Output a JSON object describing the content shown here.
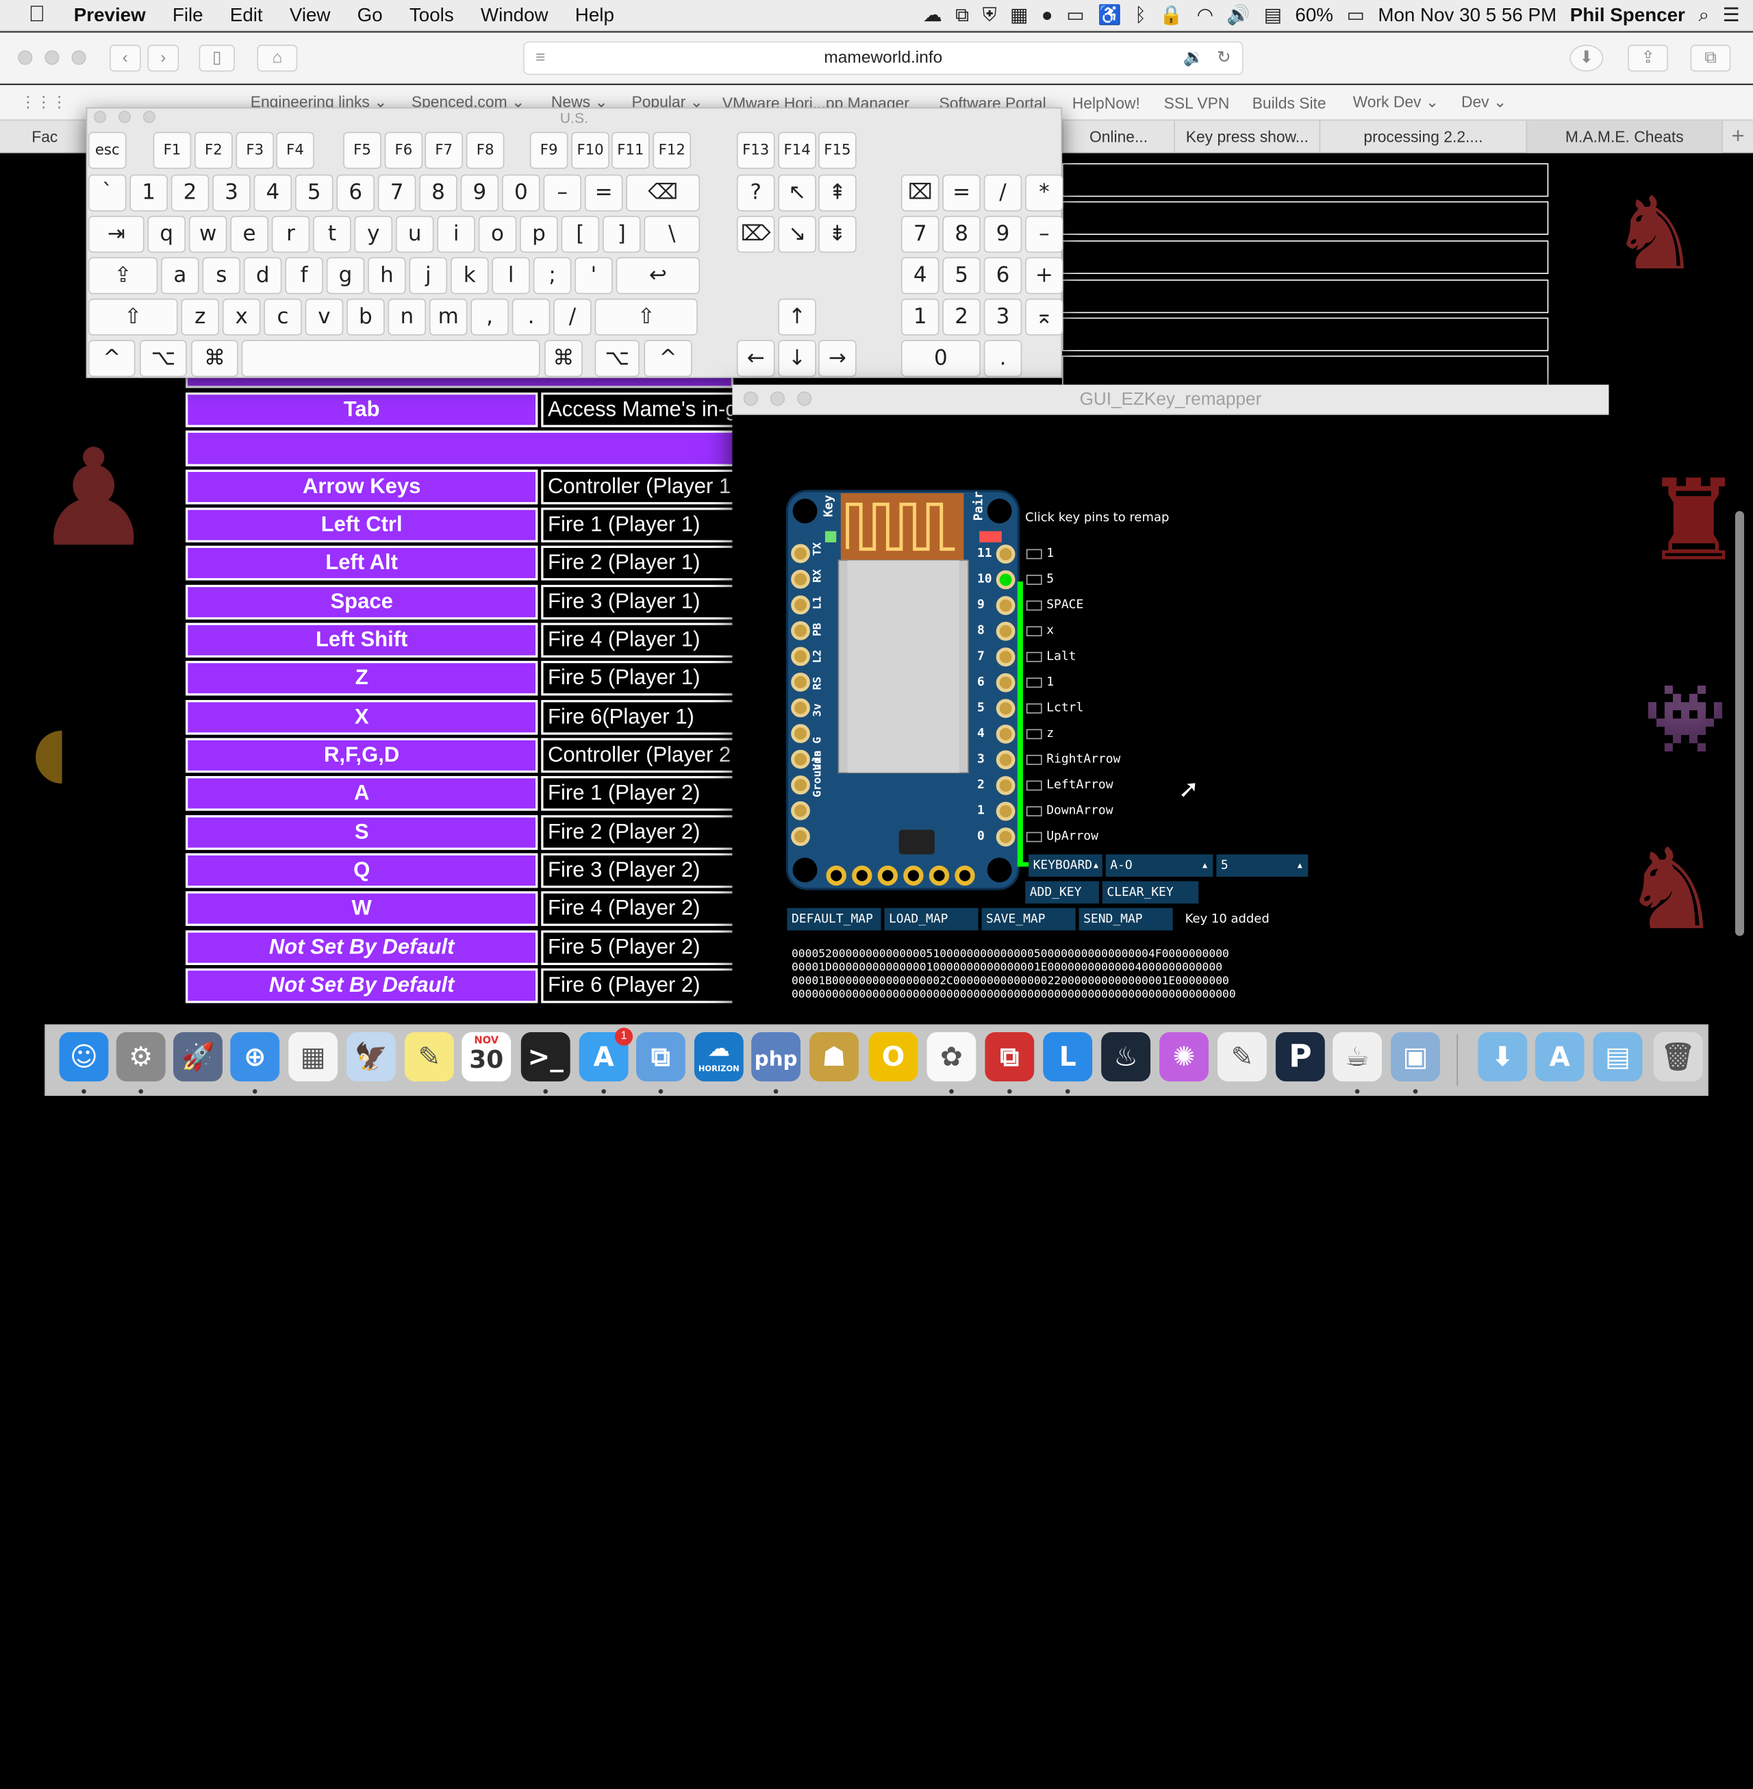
{
  "menubar": {
    "app_name": "Preview",
    "menus": [
      "File",
      "Edit",
      "View",
      "Go",
      "Tools",
      "Window",
      "Help"
    ],
    "battery": "60%",
    "clock": "Mon Nov 30  5 56 PM",
    "user": "Phil Spencer"
  },
  "browser": {
    "url": "mameworld.info",
    "favorites": [
      "Engineering links ⌄",
      "Spenced.com ⌄",
      "News ⌄",
      "Popular ⌄",
      "VMware Hori...pp Manager",
      "Software Portal",
      "HelpNow!",
      "SSL VPN",
      "Builds Site",
      "Work Dev ⌄",
      "Dev ⌄"
    ],
    "tabs": [
      "Fac",
      "Online...",
      "Key press show...",
      "processing 2.2....",
      "M.A.M.E. Cheats"
    ],
    "new_tab": "+"
  },
  "keyboard_viewer": {
    "title": "U.S.",
    "keys": {
      "esc": "esc",
      "f": [
        "F1",
        "F2",
        "F3",
        "F4",
        "F5",
        "F6",
        "F7",
        "F8",
        "F9",
        "F10",
        "F11",
        "F12",
        "F13",
        "F14",
        "F15"
      ],
      "num_row": [
        "`",
        "1",
        "2",
        "3",
        "4",
        "5",
        "6",
        "7",
        "8",
        "9",
        "0",
        "–",
        "=",
        "⌫"
      ],
      "q_row": [
        "⇥",
        "q",
        "w",
        "e",
        "r",
        "t",
        "y",
        "u",
        "i",
        "o",
        "p",
        "[",
        "]",
        "\\"
      ],
      "a_row": [
        "⇪",
        "a",
        "s",
        "d",
        "f",
        "g",
        "h",
        "j",
        "k",
        "l",
        ";",
        "'",
        "↩"
      ],
      "z_row": [
        "⇧",
        "z",
        "x",
        "c",
        "v",
        "b",
        "n",
        "m",
        ",",
        ".",
        "/",
        "⇧"
      ],
      "bottom_row": [
        "^",
        "⌥",
        "⌘",
        "⌘",
        "⌥",
        "^"
      ],
      "nav": [
        "?",
        "↖",
        "⇞",
        "⌦",
        "↘",
        "⇟",
        "↑",
        "←",
        "↓",
        "→"
      ],
      "numpad": [
        "⌧",
        "=",
        "/",
        "*",
        "7",
        "8",
        "9",
        "–",
        "4",
        "5",
        "6",
        "+",
        "1",
        "2",
        "3",
        "0",
        ".",
        "⌅"
      ]
    }
  },
  "mame_table": {
    "rows": [
      {
        "key": "Tab",
        "action": "Access Mame's in-g"
      },
      {
        "key": "Arrow Keys",
        "action": "Controller (Player 1"
      },
      {
        "key": "Left Ctrl",
        "action": "Fire 1 (Player 1)"
      },
      {
        "key": "Left Alt",
        "action": "Fire 2 (Player 1)"
      },
      {
        "key": "Space",
        "action": "Fire 3 (Player 1)"
      },
      {
        "key": "Left Shift",
        "action": "Fire 4 (Player 1)"
      },
      {
        "key": "Z",
        "action": "Fire 5 (Player 1)"
      },
      {
        "key": "X",
        "action": "Fire 6(Player 1)"
      },
      {
        "key": "R,F,G,D",
        "action": "Controller (Player 2"
      },
      {
        "key": "A",
        "action": "Fire 1 (Player 2)"
      },
      {
        "key": "S",
        "action": "Fire 2 (Player 2)"
      },
      {
        "key": "Q",
        "action": "Fire 3 (Player 2)"
      },
      {
        "key": "W",
        "action": "Fire 4 (Player 2)"
      },
      {
        "key": "Not Set By Default",
        "action": "Fire 5 (Player 2)"
      },
      {
        "key": "Not Set By Default",
        "action": "Fire 6 (Player 2)"
      }
    ]
  },
  "remapper": {
    "title": "GUI_EZKey_remapper",
    "instruction": "Click key pins to remap",
    "board_labels": {
      "key": "Key",
      "pair": "Pair",
      "left": [
        "TX",
        "RX",
        "L1",
        "PB",
        "L2",
        "RS",
        "3v",
        "G",
        "Vin",
        "Grounds"
      ]
    },
    "pins": [
      {
        "num": "11",
        "label": "1"
      },
      {
        "num": "10",
        "label": "5"
      },
      {
        "num": "9",
        "label": "SPACE"
      },
      {
        "num": "8",
        "label": "x"
      },
      {
        "num": "7",
        "label": "Lalt"
      },
      {
        "num": "6",
        "label": "1"
      },
      {
        "num": "5",
        "label": "Lctrl"
      },
      {
        "num": "4",
        "label": "z"
      },
      {
        "num": "3",
        "label": "RightArrow"
      },
      {
        "num": "2",
        "label": "LeftArrow"
      },
      {
        "num": "1",
        "label": "DownArrow"
      },
      {
        "num": "0",
        "label": "UpArrow"
      }
    ],
    "selected_pin": "10",
    "dropdown_type": "KEYBOARD",
    "dropdown_range": "A-O",
    "dropdown_value": "5",
    "add_key": "ADD_KEY",
    "clear_key": "CLEAR_KEY",
    "buttons": [
      "DEFAULT_MAP",
      "LOAD_MAP",
      "SAVE_MAP",
      "SEND_MAP"
    ],
    "status": "Key 10 added",
    "hex_lines": [
      "000052000000000000005100000000000000500000000000000004F0000000000",
      "00001D0000000000000010000000000000001E00000000000004000000000000",
      "00001B00000000000000002C00000000000000220000000000000001E00000000",
      "000000000000000000000000000000000000000000000000000000000000000000"
    ],
    "colors": {
      "board": "#1a4e7a",
      "wire": "#00ff00",
      "button": "#0e3c5c"
    }
  },
  "dock": {
    "calendar_month": "NOV",
    "calendar_day": "30",
    "appstore_badge": "1",
    "php_label": "php",
    "p_label": "P",
    "horizon_label": "HORIZON"
  },
  "colors": {
    "table_key_bg": "#9b30ff",
    "menubar_bg": "#ececec"
  }
}
